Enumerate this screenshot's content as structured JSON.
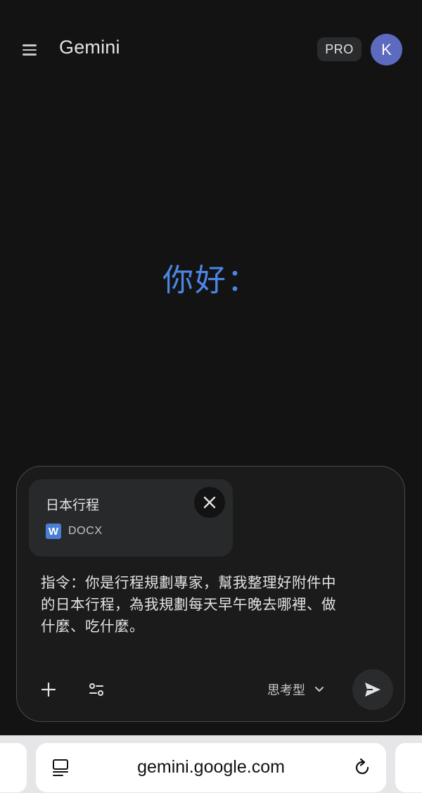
{
  "header": {
    "title": "Gemini",
    "pro_badge": "PRO",
    "avatar_initial": "K",
    "menu_icon": "menu-icon"
  },
  "greeting": "你好：",
  "composer": {
    "attachment": {
      "name": "日本行程",
      "type_label": "DOCX",
      "type_icon_letter": "W"
    },
    "prompt_lines": [
      "指令：你是行程規劃專家，幫我整理好附件中",
      "的日本行程，為我規劃每天早午晚去哪裡、做",
      "什麼、吃什麼。"
    ],
    "model_label": "思考型"
  },
  "browser": {
    "url": "gemini.google.com"
  },
  "colors": {
    "background": "#131314",
    "greeting_blue": "#4d86e6",
    "avatar": "#5c6bc0",
    "word_icon": "#4a7ed3"
  }
}
